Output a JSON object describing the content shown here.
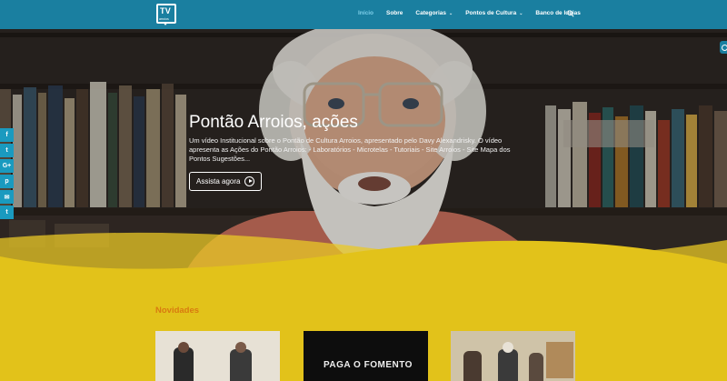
{
  "header": {
    "logo_text": "TV",
    "logo_sub": "arroios",
    "nav": [
      {
        "label": "Início",
        "dropdown": false,
        "active": true
      },
      {
        "label": "Sobre",
        "dropdown": false,
        "active": false
      },
      {
        "label": "Categorias",
        "dropdown": true,
        "active": false
      },
      {
        "label": "Pontos de Cultura",
        "dropdown": true,
        "active": false
      },
      {
        "label": "Banco de Ideias",
        "dropdown": false,
        "active": false
      }
    ]
  },
  "hero": {
    "title": "Pontão Arroios, ações",
    "description": "Um vídeo Institucional sobre o Pontão de Cultura Arroios, apresentado pelo Davy Alexandrisky. O vídeo apresenta as Ações do Pontão Arroios: - Laboratórios - Microtelas - Tutoriais - Site Arroios - Site Mapa dos Pontos   Sugestões...",
    "button_label": "Assista agora"
  },
  "social": [
    {
      "icon": "facebook-icon",
      "glyph": "f"
    },
    {
      "icon": "twitter-icon",
      "glyph": "t"
    },
    {
      "icon": "google-plus-icon",
      "glyph": "G+"
    },
    {
      "icon": "pinterest-icon",
      "glyph": "p"
    },
    {
      "icon": "email-icon",
      "glyph": "✉"
    },
    {
      "icon": "tumblr-icon",
      "glyph": "t"
    }
  ],
  "section": {
    "title": "Novidades"
  },
  "thumbnails": [
    {
      "caption": ""
    },
    {
      "caption": "",
      "big_text": "PAGA O FOMENTO"
    },
    {
      "caption": ""
    }
  ],
  "colors": {
    "header": "#1a7fa0",
    "yellow": "#e2c21a",
    "accent": "#d87a10"
  }
}
